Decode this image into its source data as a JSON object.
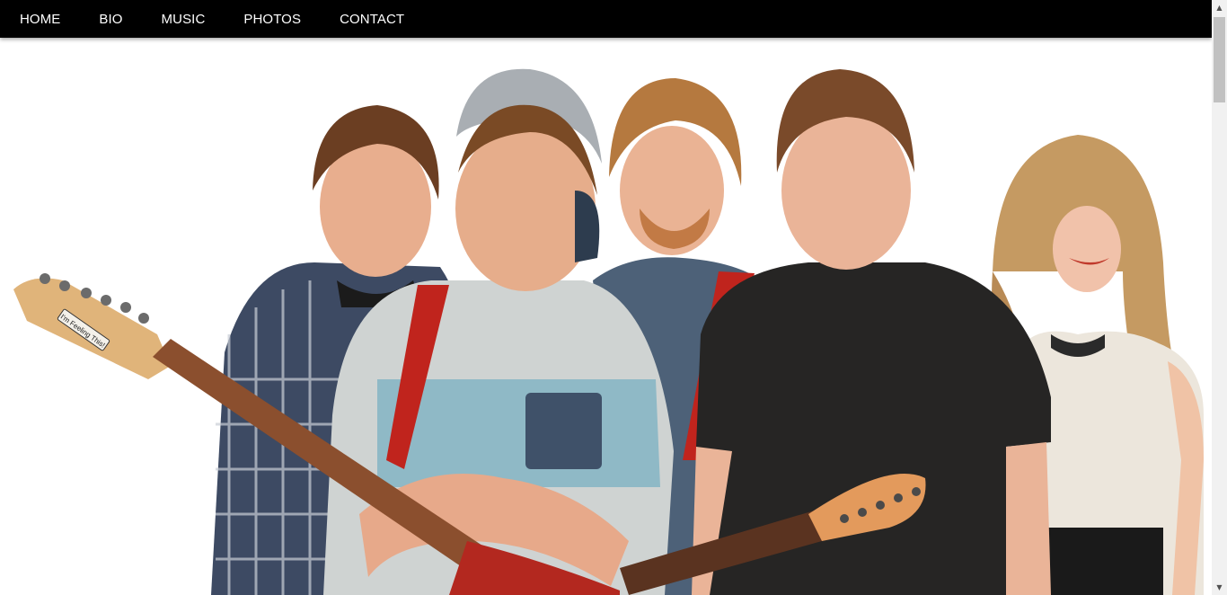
{
  "nav": {
    "items": [
      {
        "label": "HOME"
      },
      {
        "label": "BIO"
      },
      {
        "label": "MUSIC"
      },
      {
        "label": "PHOTOS"
      },
      {
        "label": "CONTACT"
      }
    ]
  },
  "hero": {
    "guitar_sticker_text": "I'm Feeling This!"
  },
  "scrollbar": {
    "up_glyph": "▲",
    "down_glyph": "▼"
  },
  "colors": {
    "nav_background": "#000000",
    "nav_text": "#ffffff",
    "page_background": "#ffffff"
  }
}
